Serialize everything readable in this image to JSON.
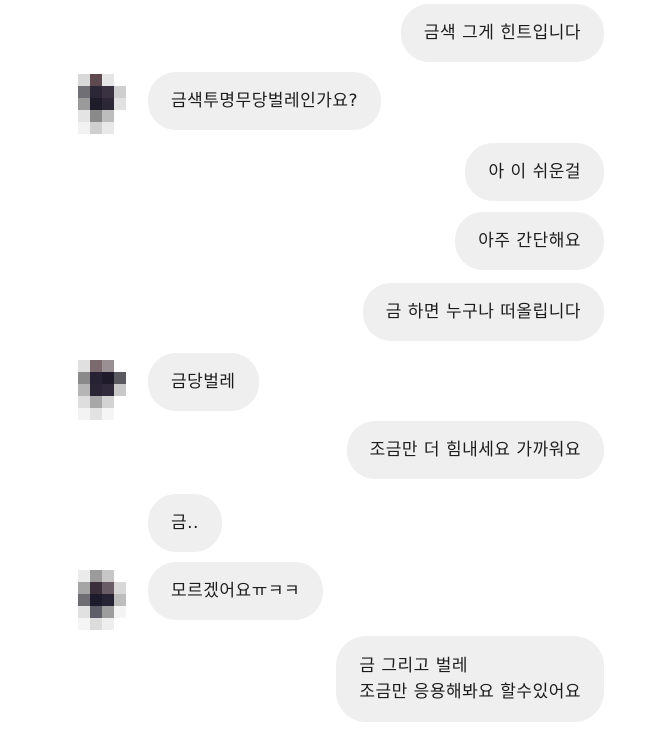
{
  "messages": [
    {
      "side": "out",
      "lines": [
        "금색 그게 힌트입니다"
      ]
    },
    {
      "side": "in",
      "avatar": true,
      "lines": [
        "금색투명무당벌레인가요?"
      ]
    },
    {
      "side": "out",
      "lines": [
        "아 이 쉬운걸"
      ]
    },
    {
      "side": "out",
      "lines": [
        "아주 간단해요"
      ]
    },
    {
      "side": "out",
      "lines": [
        "금  하면 누구나 떠올립니다"
      ]
    },
    {
      "side": "in",
      "avatar": true,
      "lines": [
        "금당벌레"
      ]
    },
    {
      "side": "out",
      "lines": [
        "조금만 더 힘내세요 가까워요"
      ]
    },
    {
      "side": "in",
      "avatar": false,
      "lines": [
        "금.."
      ]
    },
    {
      "side": "in",
      "avatar": true,
      "lines": [
        "모르겠어요ㅠㅋㅋ"
      ]
    },
    {
      "side": "out",
      "lines": [
        "금 그리고 벌레",
        "조금만 응용해봐요 할수있어요"
      ]
    }
  ],
  "colors": {
    "bubble": "#efefef",
    "text": "#1c1c1c",
    "background": "#ffffff"
  }
}
